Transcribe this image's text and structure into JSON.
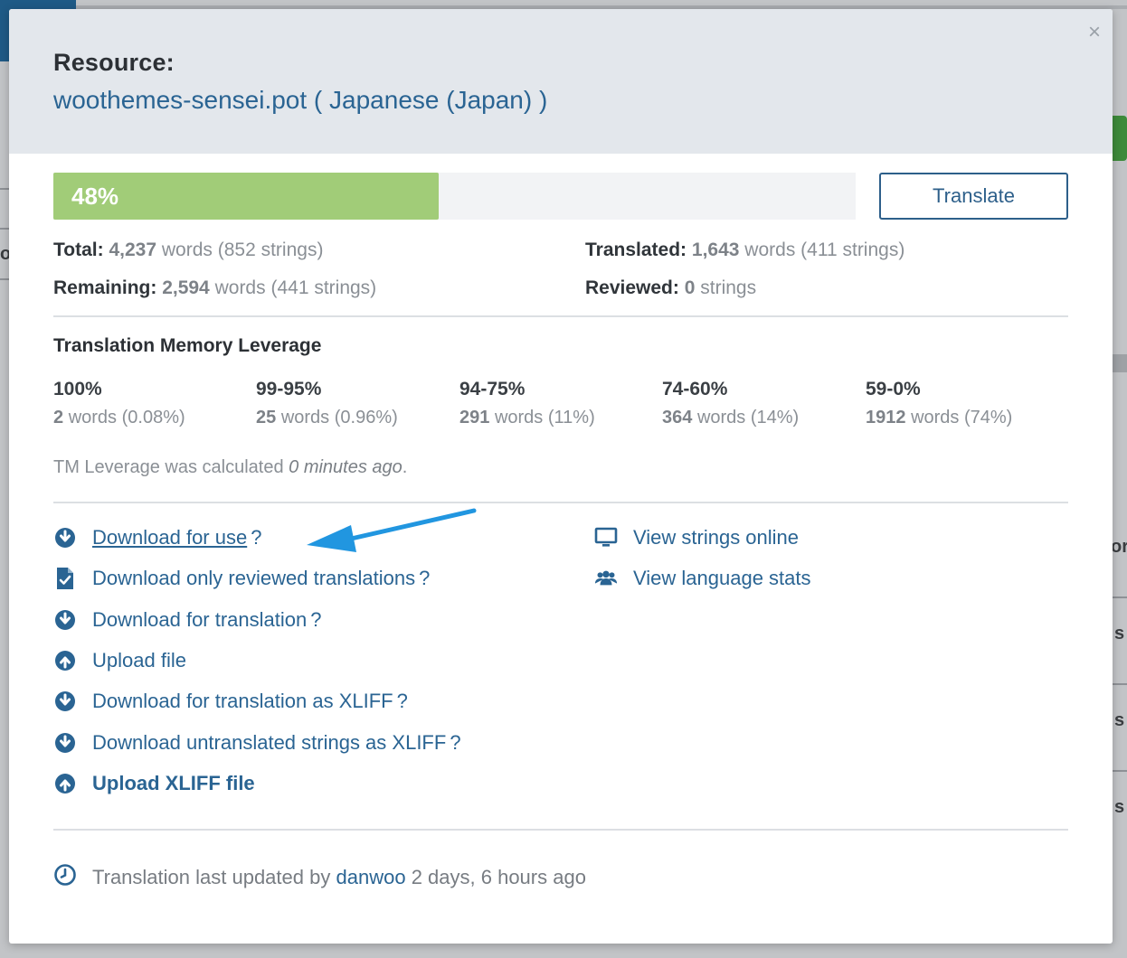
{
  "background": {
    "fragments": [
      "oj",
      "or",
      "s",
      "s",
      "s"
    ]
  },
  "modal": {
    "close_symbol": "×",
    "resource_label": "Resource:",
    "resource_name": "woothemes-sensei.pot ( Japanese (Japan) )"
  },
  "progress": {
    "percent": 48,
    "label": "48%",
    "color": "#a1cc78",
    "translate_button": "Translate"
  },
  "stats": {
    "total": {
      "label": "Total:",
      "words": "4,237",
      "words_unit": "words",
      "strings": "(852 strings)"
    },
    "remaining": {
      "label": "Remaining:",
      "words": "2,594",
      "words_unit": "words",
      "strings": "(441 strings)"
    },
    "translated": {
      "label": "Translated:",
      "words": "1,643",
      "words_unit": "words",
      "strings": "(411 strings)"
    },
    "reviewed": {
      "label": "Reviewed:",
      "count": "0",
      "unit": "strings"
    }
  },
  "tm": {
    "title": "Translation Memory Leverage",
    "columns": [
      {
        "range": "100%",
        "words": "2",
        "unit": "words",
        "pct": "(0.08%)"
      },
      {
        "range": "99-95%",
        "words": "25",
        "unit": "words",
        "pct": "(0.96%)"
      },
      {
        "range": "94-75%",
        "words": "291",
        "unit": "words",
        "pct": "(11%)"
      },
      {
        "range": "74-60%",
        "words": "364",
        "unit": "words",
        "pct": "(14%)"
      },
      {
        "range": "59-0%",
        "words": "1912",
        "unit": "words",
        "pct": "(74%)"
      }
    ],
    "note_prefix": "TM Leverage was calculated",
    "note_time": "0 minutes ago",
    "note_suffix": "."
  },
  "actions": {
    "download_for_use": {
      "label": "Download for use ",
      "help": "?",
      "icon": "download-circle-icon"
    },
    "download_reviewed": {
      "label": "Download only reviewed translations",
      "help": "?",
      "icon": "file-check-icon"
    },
    "download_for_translation": {
      "label": "Download for translation",
      "help": "?",
      "icon": "download-circle-icon"
    },
    "upload_file": {
      "label": "Upload file",
      "icon": "upload-circle-icon"
    },
    "download_xliff": {
      "label": "Download for translation as XLIFF",
      "help": "?",
      "icon": "download-circle-icon"
    },
    "download_untranslated_xliff": {
      "label": "Download untranslated strings as XLIFF",
      "help": "?",
      "icon": "download-circle-icon"
    },
    "upload_xliff": {
      "label": "Upload XLIFF file",
      "icon": "upload-circle-icon"
    },
    "view_strings_online": {
      "label": "View strings online",
      "icon": "monitor-icon"
    },
    "view_language_stats": {
      "label": "View language stats",
      "icon": "users-icon"
    }
  },
  "footer": {
    "prefix": "Translation last updated by",
    "user": "danwoo",
    "time": "2 days, 6 hours ago",
    "icon": "clock-icon"
  },
  "colors": {
    "link": "#2a6493",
    "header_bg": "#e3e7ec",
    "arrow": "#2196e0",
    "button_border": "#2d5f8a"
  }
}
